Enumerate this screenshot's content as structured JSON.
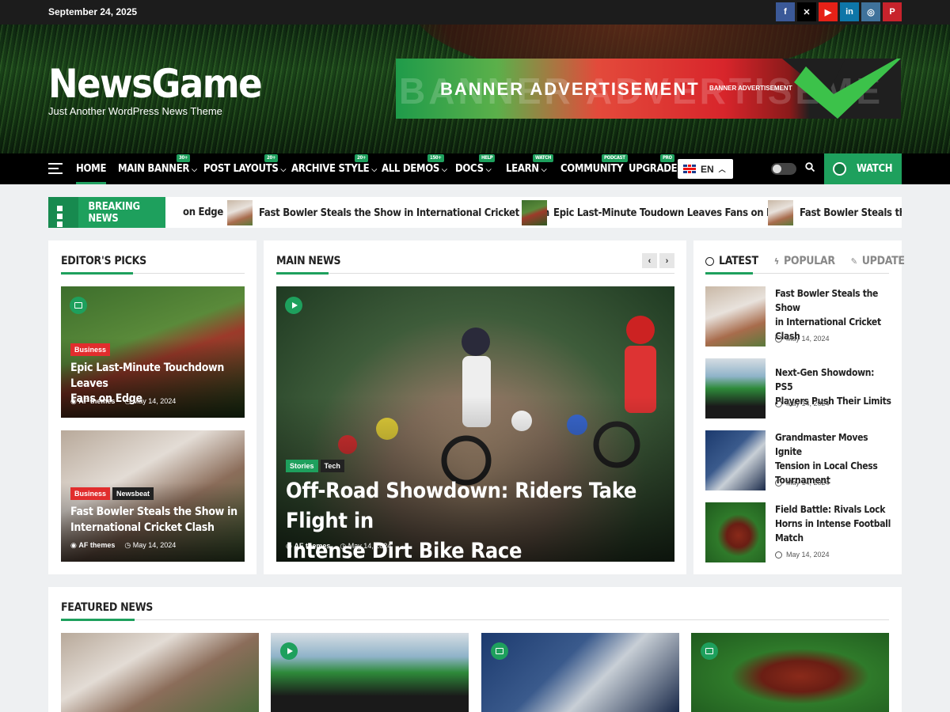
{
  "topbar": {
    "date": "September 24, 2025",
    "socials": [
      {
        "name": "facebook-icon",
        "glyph": "f",
        "color": "#3b5998"
      },
      {
        "name": "x-icon",
        "glyph": "✕",
        "color": "#000000"
      },
      {
        "name": "youtube-icon",
        "glyph": "▶",
        "color": "#e62117"
      },
      {
        "name": "linkedin-icon",
        "glyph": "in",
        "color": "#0e76a8"
      },
      {
        "name": "instagram-icon",
        "glyph": "◎",
        "color": "#3f729b"
      },
      {
        "name": "pinterest-icon",
        "glyph": "P",
        "color": "#c8232c"
      }
    ]
  },
  "header": {
    "site_title": "NewsGame",
    "tagline": "Just Another WordPress News Theme",
    "banner_main": "BANNER ADVERTISEMENT",
    "banner_ghost": "BANNER ADVERTISEME",
    "banner_small": "BANNER ADVERTISEMENT"
  },
  "nav": {
    "items": [
      {
        "label": "HOME",
        "badge": "",
        "chevron": false
      },
      {
        "label": "MAIN BANNER",
        "badge": "30+",
        "chevron": true
      },
      {
        "label": "POST LAYOUTS",
        "badge": "20+",
        "chevron": true
      },
      {
        "label": "ARCHIVE STYLE",
        "badge": "20+",
        "chevron": true
      },
      {
        "label": "ALL DEMOS",
        "badge": "150+",
        "chevron": true
      },
      {
        "label": "DOCS",
        "badge": "HELP",
        "chevron": true
      },
      {
        "label": "LEARN",
        "badge": "WATCH",
        "chevron": true
      },
      {
        "label": "COMMUNITY",
        "badge": "PODCAST",
        "chevron": false
      },
      {
        "label": "UPGRADE",
        "badge": "PRO",
        "chevron": false
      }
    ],
    "language": "EN",
    "watch_label": "WATCH"
  },
  "breaking": {
    "label": "BREAKING NEWS",
    "items": [
      "Epic Last-Minute Touchdown Leaves Fans on Edge",
      "Fast Bowler Steals the Show in International Cricket Clash",
      "Epic Last-Minute Toudown Leaves Fans on Edge",
      "Fast Bowler Steals the Show in International Cricket Clash"
    ],
    "first_fragment": "on Edge"
  },
  "editors": {
    "title": "EDITOR'S PICKS",
    "posts": [
      {
        "tags": [
          "Business"
        ],
        "title_l1": "Epic Last-Minute Touchdown Leaves",
        "title_l2": "Fans on Edge",
        "author": "AF themes",
        "date": "May 14, 2024"
      },
      {
        "tags": [
          "Business",
          "Newsbeat"
        ],
        "title_l1": "Fast Bowler Steals the Show in",
        "title_l2": "International Cricket Clash",
        "author": "AF themes",
        "date": "May 14, 2024"
      }
    ]
  },
  "main_news": {
    "title": "MAIN NEWS",
    "prev": "‹",
    "next": "›",
    "tags": [
      "Stories",
      "Tech"
    ],
    "headline_l1": "Off-Road Showdown: Riders Take Flight in",
    "headline_l2": "Intense Dirt Bike Race",
    "author": "AF themes",
    "date": "May 14, 2024"
  },
  "sidebar": {
    "tabs": [
      "LATEST",
      "POPULAR",
      "UPDATE"
    ],
    "items": [
      {
        "l1": "Fast Bowler Steals the Show",
        "l2": "in International Cricket",
        "l3": "Clash",
        "date": "May 14, 2024"
      },
      {
        "l1": "Next-Gen Showdown: PS5",
        "l2": "Players Push Their Limits",
        "l3": "",
        "date": "May 14, 2024"
      },
      {
        "l1": "Grandmaster Moves Ignite",
        "l2": "Tension in Local Chess",
        "l3": "Tournament",
        "date": "May 14, 2024"
      },
      {
        "l1": "Field Battle: Rivals Lock",
        "l2": "Horns in Intense Football",
        "l3": "Match",
        "date": "May 14, 2024"
      }
    ]
  },
  "featured": {
    "title": "FEATURED NEWS"
  },
  "colors": {
    "accent": "#1ea05d",
    "tag_red": "#e12d2d",
    "dark": "#1c1c1c"
  }
}
